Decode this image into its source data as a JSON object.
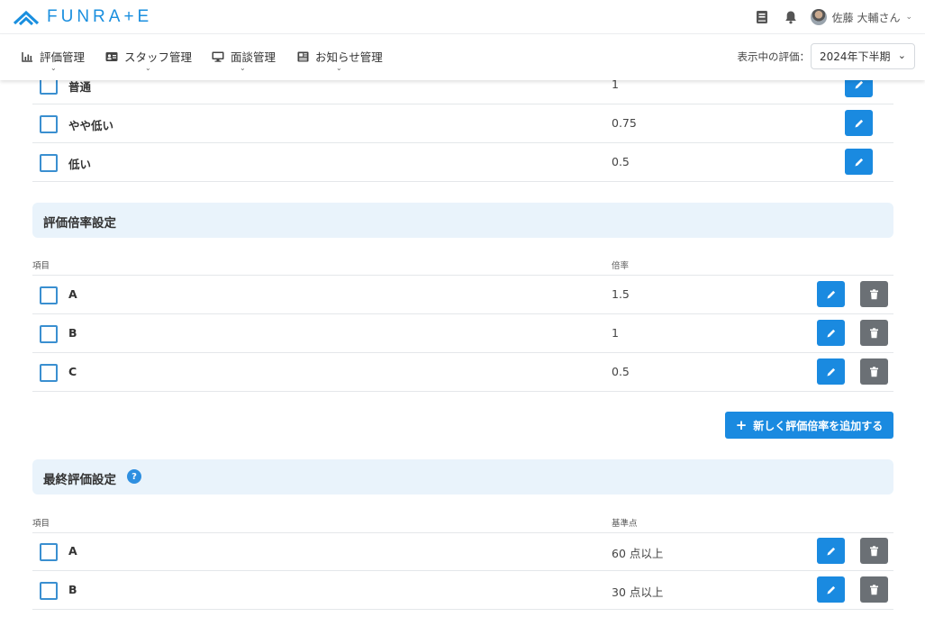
{
  "header": {
    "logo_text": "FUNRA+E",
    "user_name": "佐藤 大輔さん",
    "user_caret": "⌄"
  },
  "nav": {
    "items": [
      {
        "label": "評価管理"
      },
      {
        "label": "スタッフ管理"
      },
      {
        "label": "面談管理"
      },
      {
        "label": "お知らせ管理"
      }
    ],
    "caret": "⌄",
    "eval_label": "表示中の評価：",
    "eval_value": "2024年下半期",
    "eval_caret": "⌄"
  },
  "top_rows": [
    {
      "label": "普通",
      "value": "1"
    },
    {
      "label": "やや低い",
      "value": "0.75"
    },
    {
      "label": "低い",
      "value": "0.5"
    }
  ],
  "multiplier_section": {
    "title": "評価倍率設定",
    "col_item": "項目",
    "col_value": "倍率",
    "rows": [
      {
        "label": "A",
        "value": "1.5"
      },
      {
        "label": "B",
        "value": "1"
      },
      {
        "label": "C",
        "value": "0.5"
      }
    ],
    "add_button": "新しく評価倍率を追加する",
    "add_plus": "+"
  },
  "final_section": {
    "title": "最終評価設定",
    "help": "?",
    "col_item": "項目",
    "col_value": "基準点",
    "rows": [
      {
        "label": "A",
        "value": "60 点以上"
      },
      {
        "label": "B",
        "value": "30 点以上"
      }
    ]
  }
}
